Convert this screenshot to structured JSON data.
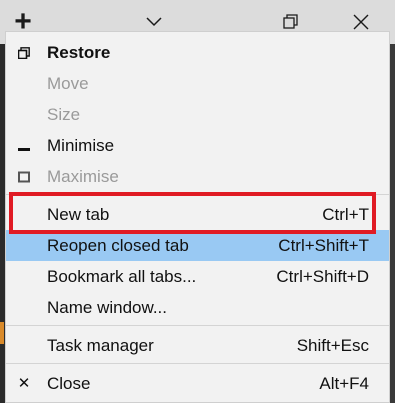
{
  "titlebar": {
    "icons": [
      "new-tab-plus-icon",
      "chevron-down-icon",
      "restore-window-icon",
      "close-window-icon"
    ],
    "glyphs": {
      "plus": "+",
      "chevron": "⌄",
      "close": "✕"
    }
  },
  "menu": {
    "restore": {
      "label": "Restore",
      "icon": "restore-icon"
    },
    "move": {
      "label": "Move"
    },
    "size": {
      "label": "Size"
    },
    "minimise": {
      "label": "Minimise",
      "icon": "minimise-icon"
    },
    "maximise": {
      "label": "Maximise",
      "icon": "maximise-icon"
    },
    "new_tab": {
      "label": "New tab",
      "shortcut": "Ctrl+T"
    },
    "reopen_closed_tab": {
      "label": "Reopen closed tab",
      "shortcut": "Ctrl+Shift+T"
    },
    "bookmark_all_tabs": {
      "label": "Bookmark all tabs...",
      "shortcut": "Ctrl+Shift+D"
    },
    "name_window": {
      "label": "Name window..."
    },
    "task_manager": {
      "label": "Task manager",
      "shortcut": "Shift+Esc"
    },
    "close": {
      "label": "Close",
      "shortcut": "Alt+F4",
      "icon": "close-icon",
      "glyph": "✕"
    }
  },
  "colors": {
    "highlight": "#99c9f3",
    "annotation": "#e01b24",
    "disabled_text": "#9a9a9a"
  }
}
